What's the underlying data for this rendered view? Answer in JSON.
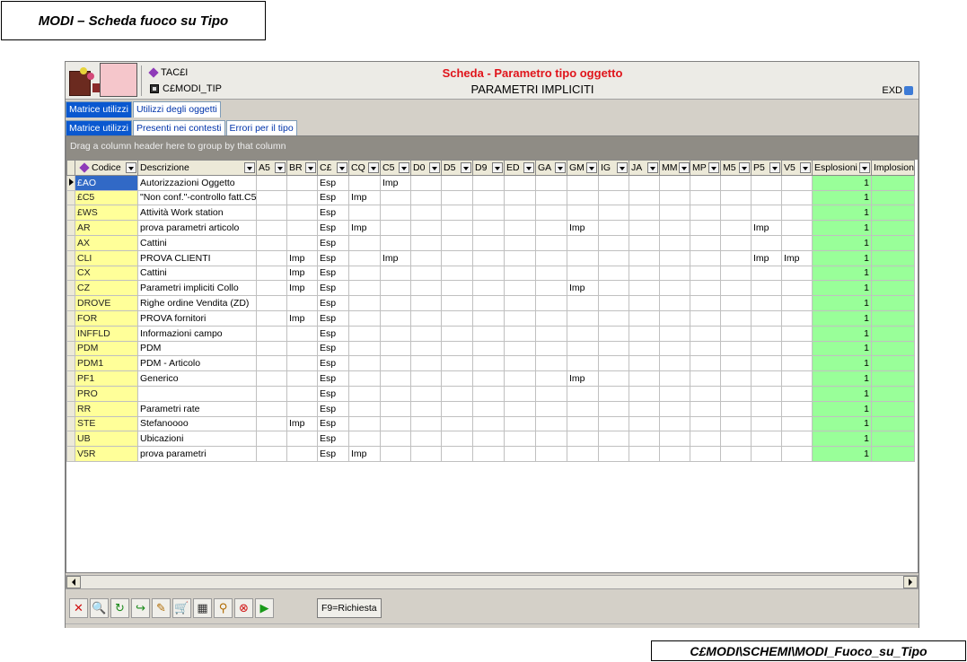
{
  "page_title": "MODI – Scheda fuoco su Tipo",
  "footer_path": "C£MODI\\SCHEMI\\MODI_Fuoco_su_Tipo",
  "header": {
    "line1": "TAC£I",
    "line2": "C£MODI_TIP",
    "title_red": "Scheda - Parametro tipo oggetto",
    "title_black": "PARAMETRI IMPLICITI",
    "right_label": "EXD",
    "colors": {
      "title_red": "#e0141b"
    }
  },
  "tabs_row1": [
    {
      "label": "Matrice utilizzi",
      "active": true
    },
    {
      "label": "Utilizzi degli oggetti",
      "active": false
    }
  ],
  "tabs_row2": [
    {
      "label": "Matrice utilizzi",
      "active": true
    },
    {
      "label": "Presenti nei contesti",
      "active": false
    },
    {
      "label": "Errori per il tipo",
      "active": false
    }
  ],
  "grid": {
    "group_hint": "Drag a column header here to group by that column",
    "columns": [
      "Codice",
      "Descrizione",
      "A5",
      "BR",
      "C£",
      "CQ",
      "C5",
      "D0",
      "D5",
      "D9",
      "ED",
      "GA",
      "GM",
      "IG",
      "JA",
      "MM",
      "MP",
      "M5",
      "P5",
      "V5",
      "Esplosioni",
      "Implosioni"
    ],
    "rows": [
      [
        "£AO",
        "Autorizzazioni Oggetto",
        "",
        "",
        "Esp",
        "",
        "Imp",
        "",
        "",
        "",
        "",
        "",
        "",
        "",
        "",
        "",
        "",
        "",
        "",
        "",
        "1",
        ""
      ],
      [
        "£C5",
        "\"Non conf.\"-controllo fatt.C5",
        "",
        "",
        "Esp",
        "Imp",
        "",
        "",
        "",
        "",
        "",
        "",
        "",
        "",
        "",
        "",
        "",
        "",
        "",
        "",
        "1",
        ""
      ],
      [
        "£WS",
        "Attività Work station",
        "",
        "",
        "Esp",
        "",
        "",
        "",
        "",
        "",
        "",
        "",
        "",
        "",
        "",
        "",
        "",
        "",
        "",
        "",
        "1",
        ""
      ],
      [
        "AR",
        "prova parametri articolo",
        "",
        "",
        "Esp",
        "Imp",
        "",
        "",
        "",
        "",
        "",
        "",
        "Imp",
        "",
        "",
        "",
        "",
        "",
        "Imp",
        "",
        "1",
        ""
      ],
      [
        "AX",
        "Cattini",
        "",
        "",
        "Esp",
        "",
        "",
        "",
        "",
        "",
        "",
        "",
        "",
        "",
        "",
        "",
        "",
        "",
        "",
        "",
        "1",
        ""
      ],
      [
        "CLI",
        "PROVA CLIENTI",
        "",
        "Imp",
        "Esp",
        "",
        "Imp",
        "",
        "",
        "",
        "",
        "",
        "",
        "",
        "",
        "",
        "",
        "",
        "Imp",
        "Imp",
        "1",
        ""
      ],
      [
        "CX",
        "Cattini",
        "",
        "Imp",
        "Esp",
        "",
        "",
        "",
        "",
        "",
        "",
        "",
        "",
        "",
        "",
        "",
        "",
        "",
        "",
        "",
        "1",
        ""
      ],
      [
        "CZ",
        "Parametri impliciti Collo",
        "",
        "Imp",
        "Esp",
        "",
        "",
        "",
        "",
        "",
        "",
        "",
        "Imp",
        "",
        "",
        "",
        "",
        "",
        "",
        "",
        "1",
        ""
      ],
      [
        "DROVE",
        "Righe ordine Vendita (ZD)",
        "",
        "",
        "Esp",
        "",
        "",
        "",
        "",
        "",
        "",
        "",
        "",
        "",
        "",
        "",
        "",
        "",
        "",
        "",
        "1",
        ""
      ],
      [
        "FOR",
        "PROVA fornitori",
        "",
        "Imp",
        "Esp",
        "",
        "",
        "",
        "",
        "",
        "",
        "",
        "",
        "",
        "",
        "",
        "",
        "",
        "",
        "",
        "1",
        ""
      ],
      [
        "INFFLD",
        "Informazioni campo",
        "",
        "",
        "Esp",
        "",
        "",
        "",
        "",
        "",
        "",
        "",
        "",
        "",
        "",
        "",
        "",
        "",
        "",
        "",
        "1",
        ""
      ],
      [
        "PDM",
        "PDM",
        "",
        "",
        "Esp",
        "",
        "",
        "",
        "",
        "",
        "",
        "",
        "",
        "",
        "",
        "",
        "",
        "",
        "",
        "",
        "1",
        ""
      ],
      [
        "PDM1",
        "PDM - Articolo",
        "",
        "",
        "Esp",
        "",
        "",
        "",
        "",
        "",
        "",
        "",
        "",
        "",
        "",
        "",
        "",
        "",
        "",
        "",
        "1",
        ""
      ],
      [
        "PF1",
        "Generico",
        "",
        "",
        "Esp",
        "",
        "",
        "",
        "",
        "",
        "",
        "",
        "Imp",
        "",
        "",
        "",
        "",
        "",
        "",
        "",
        "1",
        ""
      ],
      [
        "PRO",
        "",
        "",
        "",
        "Esp",
        "",
        "",
        "",
        "",
        "",
        "",
        "",
        "",
        "",
        "",
        "",
        "",
        "",
        "",
        "",
        "1",
        ""
      ],
      [
        "RR",
        "Parametri rate",
        "",
        "",
        "Esp",
        "",
        "",
        "",
        "",
        "",
        "",
        "",
        "",
        "",
        "",
        "",
        "",
        "",
        "",
        "",
        "1",
        ""
      ],
      [
        "STE",
        "Stefanoooo",
        "",
        "Imp",
        "Esp",
        "",
        "",
        "",
        "",
        "",
        "",
        "",
        "",
        "",
        "",
        "",
        "",
        "",
        "",
        "",
        "1",
        ""
      ],
      [
        "UB",
        "Ubicazioni",
        "",
        "",
        "Esp",
        "",
        "",
        "",
        "",
        "",
        "",
        "",
        "",
        "",
        "",
        "",
        "",
        "",
        "",
        "",
        "1",
        ""
      ],
      [
        "V5R",
        "prova parametri",
        "",
        "",
        "Esp",
        "Imp",
        "",
        "",
        "",
        "",
        "",
        "",
        "",
        "",
        "",
        "",
        "",
        "",
        "",
        "",
        "1",
        ""
      ]
    ],
    "selected_row": 0,
    "colors": {
      "code_bg": "#ffff99",
      "count_bg": "#99ff99",
      "selected_bg": "#3169c6"
    }
  },
  "toolbar": {
    "buttons": [
      "close-icon",
      "search-icon",
      "refresh-icon",
      "export-icon",
      "edit-icon",
      "cart-icon",
      "table-icon",
      "zoom-icon",
      "stop-icon",
      "play-icon"
    ],
    "f9_label": "F9=Richiesta"
  }
}
